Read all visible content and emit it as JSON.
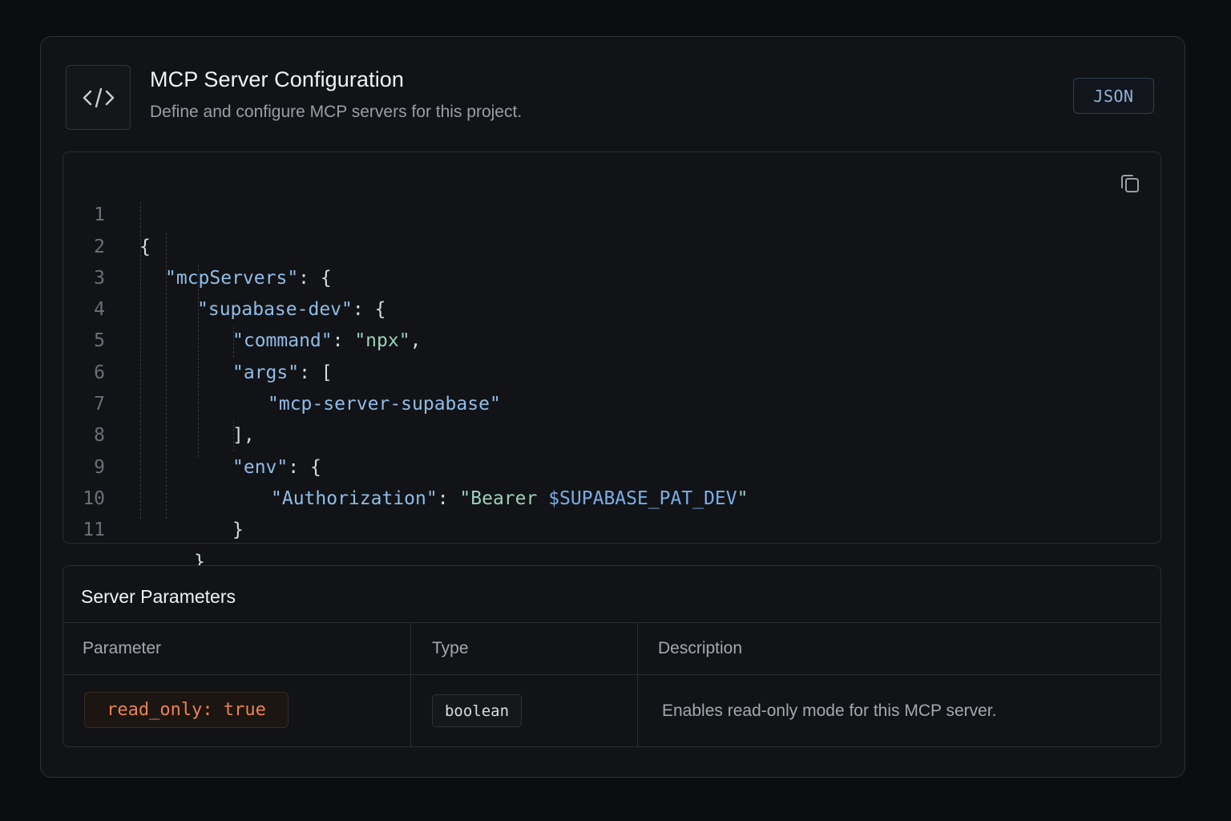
{
  "header": {
    "icon": "code-icon",
    "title": "MCP Server Configuration",
    "subtitle": "Define and configure MCP servers for this project.",
    "format_badge": "JSON"
  },
  "code": {
    "language": "json",
    "lines": [
      {
        "n": "1"
      },
      {
        "n": "2",
        "key": "\"mcpServers\"",
        "punct": ": {"
      },
      {
        "n": "3",
        "key": "\"supabase-dev\"",
        "punct": ": {"
      },
      {
        "n": "4",
        "key": "\"command\"",
        "punct": ": ",
        "str": "\"npx\"",
        "trail": ","
      },
      {
        "n": "5",
        "key": "\"args\"",
        "punct": ": ["
      },
      {
        "n": "6",
        "key": "\"mcp-server-supabase\""
      },
      {
        "n": "7"
      },
      {
        "n": "8",
        "key": "\"env\"",
        "punct": ": {"
      },
      {
        "n": "9",
        "key": "\"Authorization\"",
        "punct": ": ",
        "str": "\"Bearer ",
        "var": "$SUPABASE_PAT_DEV",
        "trail": "\""
      },
      {
        "n": "10"
      },
      {
        "n": "11"
      }
    ],
    "plain": {
      "l1": "{",
      "l7": "],",
      "l10": "}",
      "l11": "}"
    }
  },
  "params": {
    "title": "Server Parameters",
    "columns": [
      "Parameter",
      "Type",
      "Description"
    ],
    "rows": [
      {
        "parameter": "read_only: true",
        "type": "boolean",
        "description": "Enables read-only mode for this MCP server."
      }
    ]
  },
  "colors": {
    "background": "#0c0d10",
    "card": "#121316",
    "key": "#8fbde8",
    "string": "#9cd1b8",
    "variable": "#79aee8",
    "param_accent": "#e98352",
    "badge_accent": "#8fb3dc"
  }
}
